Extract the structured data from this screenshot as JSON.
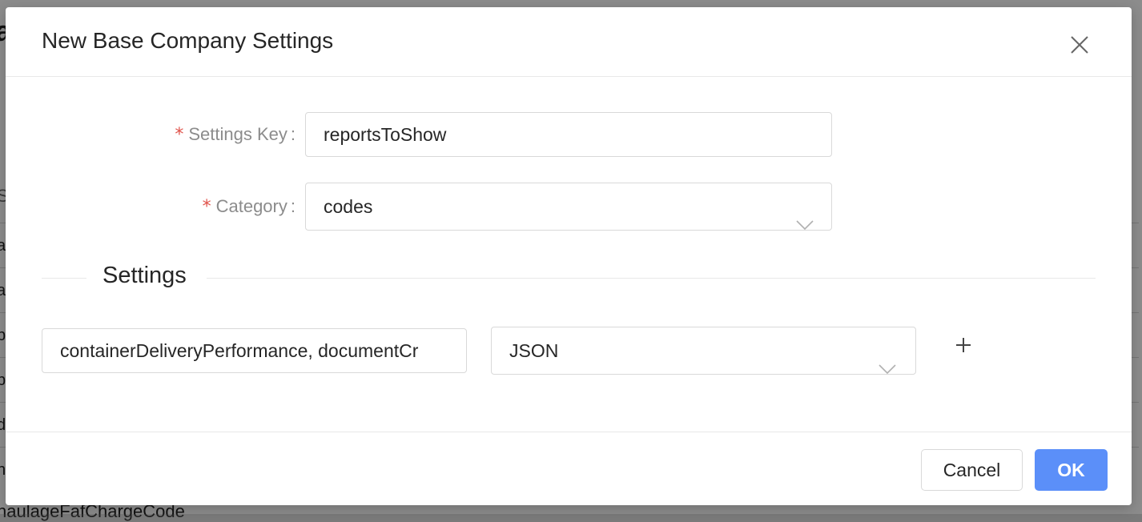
{
  "background": {
    "header_char": "a",
    "column_header_char": "S",
    "row_chars": [
      "a",
      "a",
      "b",
      "b",
      "d",
      "h"
    ],
    "bottom_row_text": "haulageFafChargeCode"
  },
  "modal": {
    "title": "New Base Company Settings",
    "close_icon": "close-icon",
    "fields": {
      "settings_key": {
        "required_mark": "*",
        "label": "Settings Key",
        "colon": ":",
        "value": "reportsToShow"
      },
      "category": {
        "required_mark": "*",
        "label": "Category",
        "colon": ":",
        "value": "codes",
        "icon": "chevron-down-icon"
      }
    },
    "settings_section": {
      "title": "Settings",
      "row": {
        "value_input": "containerDeliveryPerformance, documentCr",
        "type_select": "JSON",
        "add_icon": "plus-icon"
      }
    },
    "footer": {
      "cancel_label": "Cancel",
      "ok_label": "OK"
    }
  },
  "colors": {
    "primary": "#5b8ff9",
    "required": "#e0524a",
    "label": "#8c8c8c",
    "border": "#d9d9d9"
  }
}
